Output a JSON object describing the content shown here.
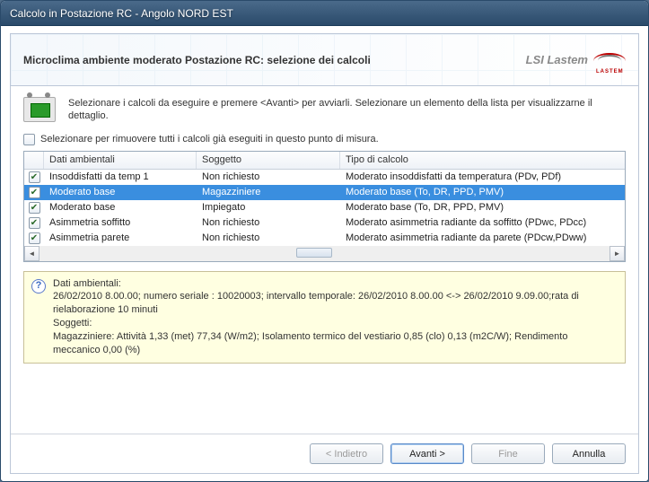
{
  "window": {
    "title": "Calcolo in  Postazione RC - Angolo NORD EST"
  },
  "header": {
    "title": "Microclima ambiente moderato Postazione RC: selezione dei calcoli",
    "brand": "LSI Lastem"
  },
  "intro": "Selezionare i calcoli da eseguire e premere <Avanti> per avviarli. Selezionare un elemento della lista per visualizzarne il dettaglio.",
  "remove_all": "Selezionare per rimuovere tutti i calcoli già eseguiti in questo punto di misura.",
  "columns": {
    "c1": "Dati ambientali",
    "c2": "Soggetto",
    "c3": "Tipo di calcolo"
  },
  "rows": [
    {
      "checked": true,
      "selected": false,
      "c1": "Insoddisfatti da temp 1",
      "c2": "Non richiesto",
      "c3": "Moderato insoddisfatti da temperatura (PDv, PDf)"
    },
    {
      "checked": true,
      "selected": true,
      "c1": "Moderato base",
      "c2": "Magazziniere",
      "c3": "Moderato base (To, DR, PPD, PMV)"
    },
    {
      "checked": true,
      "selected": false,
      "c1": "Moderato base",
      "c2": "Impiegato",
      "c3": "Moderato base (To, DR, PPD, PMV)"
    },
    {
      "checked": true,
      "selected": false,
      "c1": "Asimmetria soffitto",
      "c2": "Non richiesto",
      "c3": "Moderato asimmetria radiante da soffitto (PDwc, PDcc)"
    },
    {
      "checked": true,
      "selected": false,
      "c1": "Asimmetria parete",
      "c2": "Non richiesto",
      "c3": "Moderato asimmetria radiante da parete (PDcw,PDww)"
    }
  ],
  "info": {
    "l1": "Dati ambientali:",
    "l2": "26/02/2010 8.00.00; numero seriale : 10020003; intervallo temporale: 26/02/2010 8.00.00 <-> 26/02/2010 9.09.00;rata di rielaborazione 10 minuti",
    "l3": "Soggetti:",
    "l4": "Magazziniere: Attività 1,33 (met) 77,34 (W/m2); Isolamento termico del vestiario 0,85 (clo) 0,13 (m2C/W); Rendimento meccanico 0,00 (%)"
  },
  "buttons": {
    "back": "< Indietro",
    "next": "Avanti >",
    "finish": "Fine",
    "cancel": "Annulla"
  }
}
